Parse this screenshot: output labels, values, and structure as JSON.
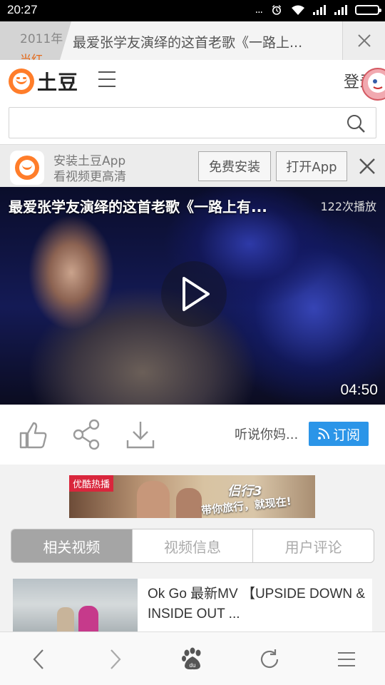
{
  "status_bar": {
    "time": "20:27",
    "dots": "...",
    "icons": [
      "alarm-icon",
      "wifi-icon",
      "signal-icon",
      "signal-icon",
      "battery-icon"
    ]
  },
  "browser": {
    "prev_tab_title": "2011年",
    "prev_tab_subtitle": "当红",
    "current_tab_title": "最爱张学友演绎的这首老歌《一路上..."
  },
  "site": {
    "logo_text": "土豆",
    "login_label": "登录",
    "search": {
      "value": "",
      "placeholder": ""
    }
  },
  "app_banner": {
    "line1": "安装土豆App",
    "line2": "看视频更高清",
    "install_label": "免费安装",
    "open_label": "打开App"
  },
  "video": {
    "title": "最爱张学友演绎的这首老歌《一路上有...",
    "plays": "122次播放",
    "duration": "04:50"
  },
  "actions": {
    "channel_name": "听说你妈...",
    "subscribe_label": "订阅"
  },
  "ad": {
    "tag": "优酷热播",
    "slogan_main": "侣行3",
    "slogan_sub": "带你旅行，就现在!"
  },
  "tabs": [
    {
      "label": "相关视频",
      "active": true
    },
    {
      "label": "视频信息",
      "active": false
    },
    {
      "label": "用户评论",
      "active": false
    }
  ],
  "related": [
    {
      "title": "Ok Go 最新MV 【UPSIDE DOWN & INSIDE OUT ..."
    }
  ],
  "colors": {
    "brand_orange": "#ff7d2a",
    "subscribe_blue": "#2b95e8",
    "ad_tag_red": "#d9263c"
  }
}
